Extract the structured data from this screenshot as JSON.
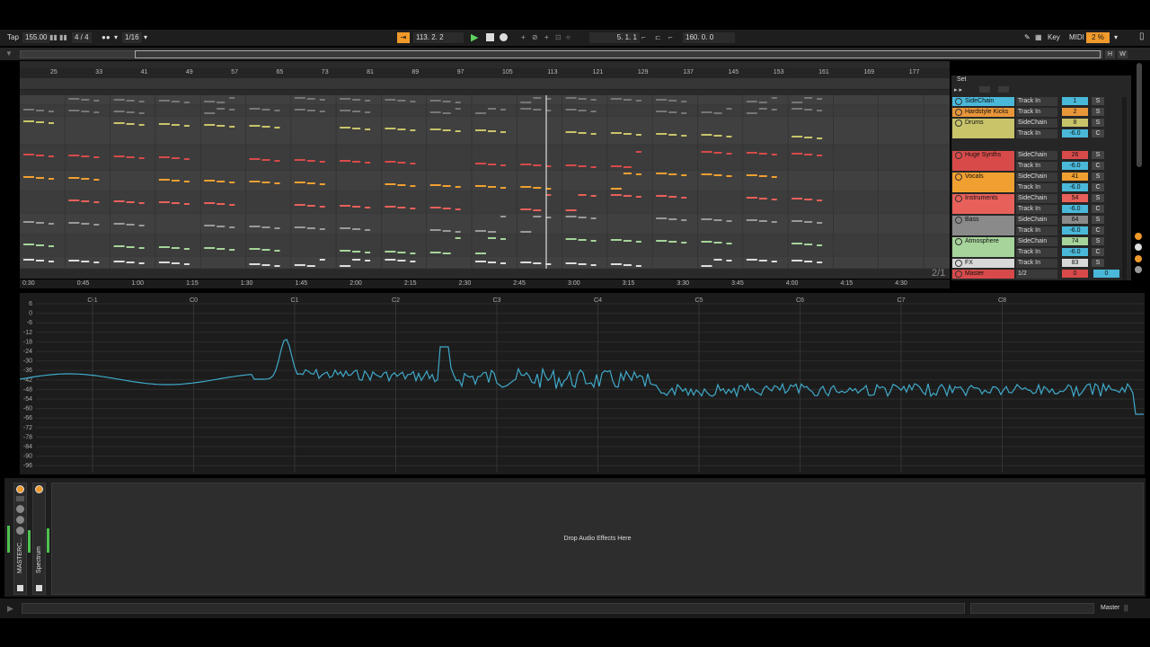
{
  "transport": {
    "tap": "Tap",
    "tempo": "155.00",
    "signature": "4 / 4",
    "quantize": "1/16",
    "position": "113.  2.  2",
    "loop_start": "5.  1.  1",
    "loop_length": "160.  0.  0",
    "key": "Key",
    "midi": "MIDI",
    "cpu": "2 %",
    "h": "H",
    "w": "W"
  },
  "ruler": {
    "bars": [
      "25",
      "33",
      "41",
      "49",
      "57",
      "65",
      "73",
      "81",
      "89",
      "97",
      "105",
      "113",
      "121",
      "129",
      "137",
      "145",
      "153",
      "161",
      "169",
      "177"
    ],
    "times": [
      "0:30",
      "0:45",
      "1:00",
      "1:15",
      "1:30",
      "1:45",
      "2:00",
      "2:15",
      "2:30",
      "2:45",
      "3:00",
      "3:15",
      "3:30",
      "3:45",
      "4:00",
      "4:15",
      "4:30"
    ]
  },
  "set_label": "Set",
  "zoom_label": "2/1",
  "tracks": [
    {
      "name": "SideChain",
      "input": "Track In",
      "num": "1",
      "color": "#4ab8d8",
      "btn": "S"
    },
    {
      "name": "Hardstyle Kicks",
      "input": "Track In",
      "num": "2",
      "color": "#e8963a",
      "btn": "S"
    },
    {
      "name": "Drums",
      "input": "SideChain",
      "input2": "Track In",
      "num": "8",
      "vol": "-6.0",
      "color": "#c9c46a",
      "btn": "S"
    },
    {
      "name": "Huge Synths",
      "input": "SideChain",
      "input2": "Track In",
      "num": "26",
      "vol": "-6.0",
      "color": "#d84a4a",
      "btn": "S"
    },
    {
      "name": "Vocals",
      "input": "SideChain",
      "input2": "Track In",
      "num": "41",
      "vol": "-6.0",
      "color": "#f0a030",
      "btn": "S"
    },
    {
      "name": "Instruments",
      "input": "SideChain",
      "input2": "Track In",
      "num": "54",
      "vol": "-6.0",
      "color": "#e8605a",
      "btn": "S"
    },
    {
      "name": "Bass",
      "input": "SideChain",
      "input2": "Track In",
      "num": "64",
      "vol": "-6.0",
      "color": "#8a8a8a",
      "btn": "S"
    },
    {
      "name": "Atmosphere",
      "input": "SideChain",
      "input2": "Track In",
      "num": "74",
      "vol": "-6.0",
      "color": "#a6d49a",
      "btn": "S"
    },
    {
      "name": "FX",
      "input": "Track In",
      "num": "83",
      "color": "#d8d8d8",
      "btn": "S"
    },
    {
      "name": "Master",
      "input": "1/2",
      "num": "0",
      "num2": "0",
      "color": "#d84a4a"
    }
  ],
  "vol_c": "C",
  "spectrum": {
    "db_labels": [
      "6",
      "0",
      "-6",
      "-12",
      "-18",
      "-24",
      "-30",
      "-36",
      "-42",
      "-48",
      "-54",
      "-60",
      "-66",
      "-72",
      "-78",
      "-84",
      "-90",
      "-96"
    ],
    "note_labels": [
      "C-1",
      "C0",
      "C1",
      "C2",
      "C3",
      "C4",
      "C5",
      "C6",
      "C7",
      "C8"
    ],
    "color": "#3fa9c9"
  },
  "devices": {
    "master_label": "MASTERC...",
    "spectrum_label": "Spectrum",
    "drop_text": "Drop Audio Effects Here"
  },
  "status": {
    "master": "Master"
  }
}
